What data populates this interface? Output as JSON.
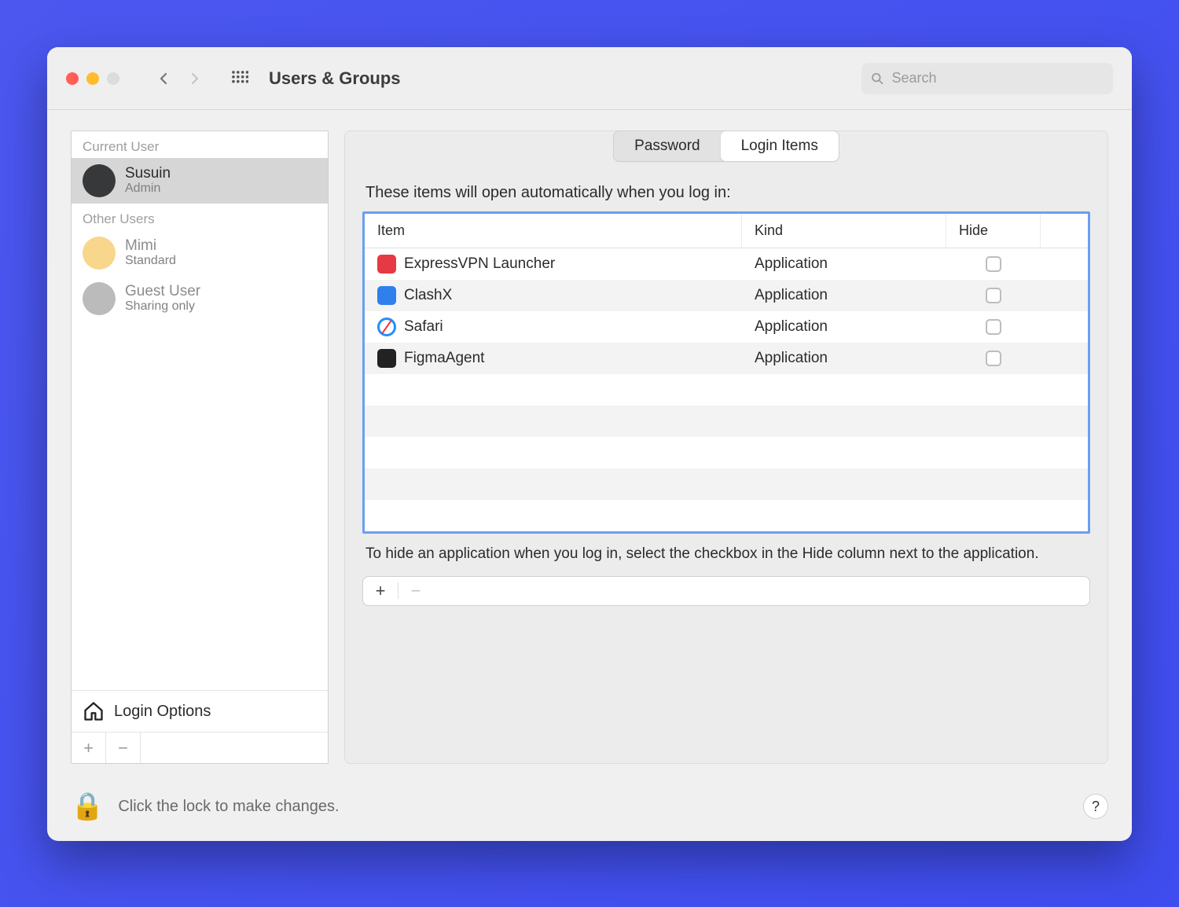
{
  "window": {
    "title": "Users & Groups",
    "search_placeholder": "Search"
  },
  "sidebar": {
    "current_user_label": "Current User",
    "other_users_label": "Other Users",
    "current_user": {
      "name": "Susuin",
      "role": "Admin"
    },
    "other_users": [
      {
        "name": "Mimi",
        "role": "Standard"
      },
      {
        "name": "Guest User",
        "role": "Sharing only"
      }
    ],
    "login_options_label": "Login Options"
  },
  "tabs": {
    "password": "Password",
    "login_items": "Login Items"
  },
  "main": {
    "intro": "These items will open automatically when you log in:",
    "columns": {
      "item": "Item",
      "kind": "Kind",
      "hide": "Hide"
    },
    "items": [
      {
        "name": "ExpressVPN Launcher",
        "kind": "Application",
        "hide": false,
        "icon": "icon-red"
      },
      {
        "name": "ClashX",
        "kind": "Application",
        "hide": false,
        "icon": "icon-blue"
      },
      {
        "name": "Safari",
        "kind": "Application",
        "hide": false,
        "icon": "icon-safari"
      },
      {
        "name": "FigmaAgent",
        "kind": "Application",
        "hide": false,
        "icon": "icon-figma"
      }
    ],
    "hint": "To hide an application when you log in, select the checkbox in the Hide column next to the application."
  },
  "footer": {
    "lock_text": "Click the lock to make changes."
  }
}
